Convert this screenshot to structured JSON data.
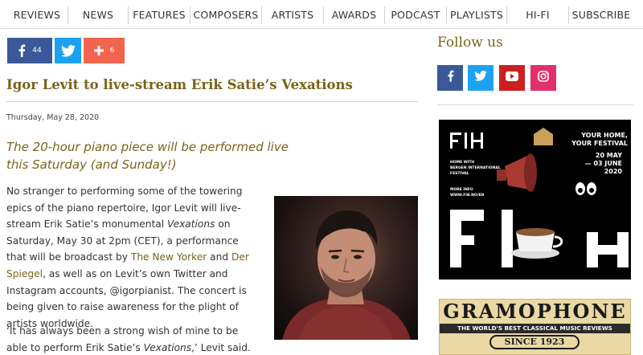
{
  "nav": {
    "items": [
      "REVIEWS",
      "NEWS",
      "FEATURES",
      "COMPOSERS",
      "ARTISTS",
      "AWARDS",
      "PODCAST",
      "PLAYLISTS",
      "HI-FI",
      "SUBSCRIBE"
    ]
  },
  "share": {
    "facebook_count": "44",
    "more_count": "6",
    "facebook_color": "#3b5998",
    "twitter_color": "#1da1f2",
    "more_color": "#f2644d"
  },
  "article": {
    "title": "Igor Levit to live-stream Erik Satie’s Vexations",
    "date": "Thursday, May 28, 2020",
    "standfirst": "The 20-hour piano piece will be performed live this Saturday (and Sunday!)",
    "p1_a": "No stranger to performing some of the towering epics of the piano repertoire, Igor Levit will live-stream Erik Satie’s monumental ",
    "p1_em": "Vexations",
    "p1_b": " on Saturday, May 30 at 2pm (CET), a performance that will be broadcast by ",
    "p1_link1": "The New Yorker",
    "p1_c": " and ",
    "p1_link2": "Der Spiegel",
    "p1_d": ", as well as on Levit’s own Twitter and Instagram accounts, @igorpianist. The concert is being given to raise awareness for the plight of artists worldwide.",
    "p2_a": "‘It has always been a strong wish of mine to be able to perform Erik Satie’s ",
    "p2_em": "Vexations",
    "p2_b": ",’ Levit said. ‘While",
    "accent_color": "#7a6318"
  },
  "sidebar": {
    "follow_title": "Follow us",
    "social_icons": [
      "facebook-icon",
      "twitter-icon",
      "youtube-icon",
      "instagram-icon"
    ],
    "social_colors": [
      "#3b5998",
      "#1da1f2",
      "#cc1f1f",
      "#e1306c"
    ],
    "ad1": {
      "logo": "FIH",
      "tagline_1": "YOUR HOME,",
      "tagline_2": "YOUR FESTIVAL",
      "dates_1": "20 MAY",
      "dates_2": "— 03 JUNE",
      "dates_3": "2020",
      "festival_1": "HOME WITH",
      "festival_2": "BERGEN INTERNATIONAL",
      "festival_3": "FESTIVAL",
      "more_1": "MORE INFO",
      "more_2": "WWW.FIB.NO/EN"
    },
    "ad2": {
      "brand": "GRAMOPHONE",
      "tagline": "THE WORLD'S BEST CLASSICAL MUSIC REVIEWS",
      "since": "SINCE 1923"
    }
  }
}
